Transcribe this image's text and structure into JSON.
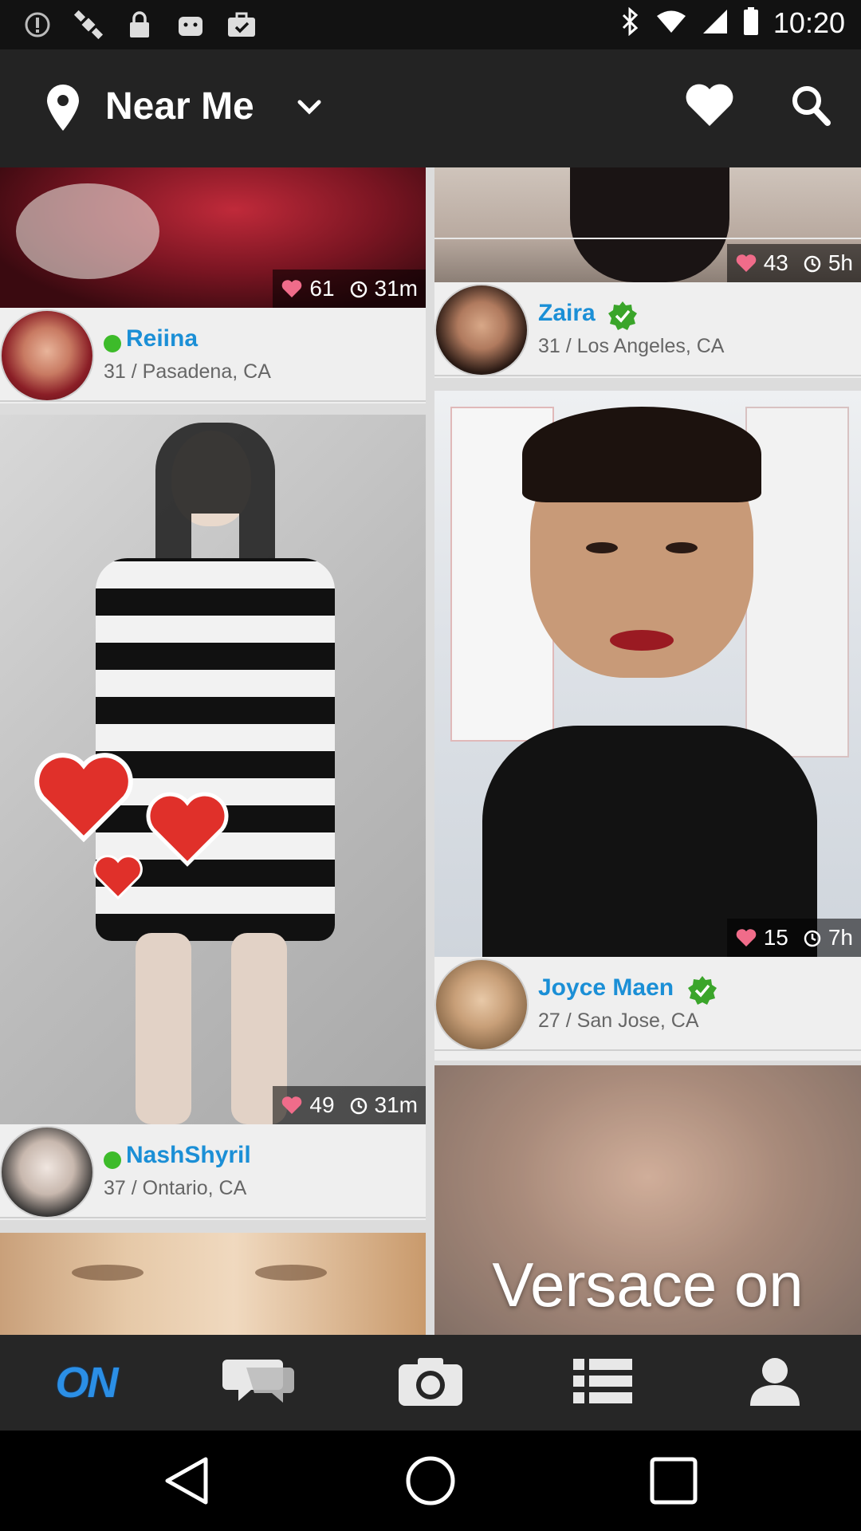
{
  "status_bar": {
    "time": "10:20",
    "left_icons": [
      "alert-icon",
      "satellite-icon",
      "lock-icon",
      "android-icon",
      "briefcase-check-icon"
    ],
    "right_icons": [
      "bluetooth-icon",
      "wifi-icon",
      "signal-icon",
      "battery-icon"
    ]
  },
  "app_bar": {
    "title": "Near Me",
    "icons": [
      "location-pin-icon",
      "chevron-down-icon",
      "heart-icon",
      "search-icon"
    ]
  },
  "profiles": [
    {
      "name": "Reiina",
      "details": "31 / Pasadena, CA",
      "likes": "61",
      "time": "31m",
      "online": true,
      "verified": false
    },
    {
      "name": "Zaira",
      "details": "31 / Los Angeles, CA",
      "likes": "43",
      "time": "5h",
      "online": false,
      "verified": true
    },
    {
      "name": "NashShyril",
      "details": "37 / Ontario, CA",
      "likes": "49",
      "time": "31m",
      "online": true,
      "verified": false
    },
    {
      "name": "Joyce Maen",
      "details": "27 / San Jose, CA",
      "likes": "15",
      "time": "7h",
      "online": false,
      "verified": true
    }
  ],
  "promo_text": "Versace on",
  "bottom_nav": {
    "logo_text": "ON",
    "items": [
      "on-logo",
      "chat-bubbles-icon",
      "camera-icon",
      "list-icon",
      "profile-icon"
    ]
  },
  "colors": {
    "accent_blue": "#1b8fd6",
    "online_green": "#3dbb2a",
    "verified_green": "#3aa52a",
    "like_pink": "#f06c8a"
  }
}
